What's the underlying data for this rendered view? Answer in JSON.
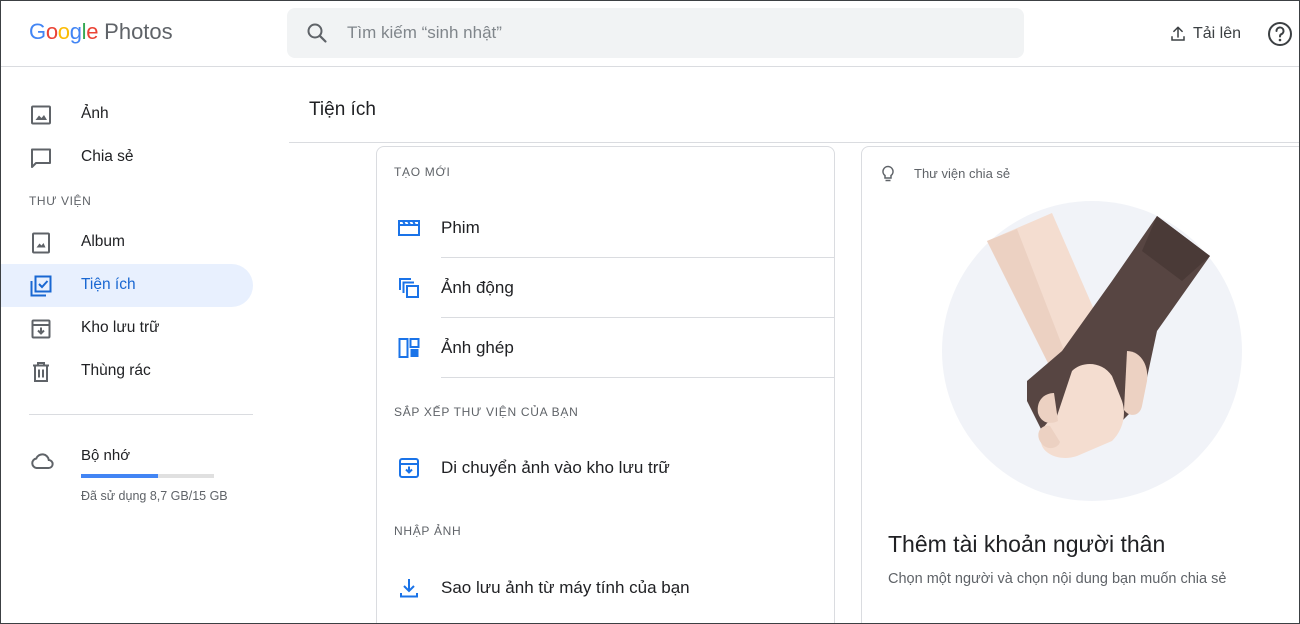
{
  "header": {
    "logo": {
      "google_letters": [
        {
          "char": "G",
          "color": "#4285F4"
        },
        {
          "char": "o",
          "color": "#EA4335"
        },
        {
          "char": "o",
          "color": "#FBBC05"
        },
        {
          "char": "g",
          "color": "#4285F4"
        },
        {
          "char": "l",
          "color": "#34A853"
        },
        {
          "char": "e",
          "color": "#EA4335"
        }
      ],
      "product": "Photos"
    },
    "search": {
      "placeholder": "Tìm kiếm “sinh nhật”",
      "icon": "search-icon"
    },
    "upload_label": "Tải lên",
    "help_icon": "help-icon"
  },
  "sidebar": {
    "items": [
      {
        "label": "Ảnh",
        "icon": "photo-icon"
      },
      {
        "label": "Chia sẻ",
        "icon": "chat-icon"
      }
    ],
    "library_label": "THƯ VIỆN",
    "library_items": [
      {
        "label": "Album",
        "icon": "album-icon"
      },
      {
        "label": "Tiện ích",
        "icon": "utilities-icon",
        "active": true
      },
      {
        "label": "Kho lưu trữ",
        "icon": "archive-icon"
      },
      {
        "label": "Thùng rác",
        "icon": "trash-icon"
      }
    ],
    "storage": {
      "title": "Bộ nhớ",
      "used_text": "Đã sử dụng 8,7 GB/15 GB",
      "used_fraction": 0.58,
      "icon": "cloud-icon"
    }
  },
  "main": {
    "title": "Tiện ích",
    "create": {
      "label": "TẠO MỚI",
      "items": [
        {
          "label": "Phim",
          "icon": "movie-icon"
        },
        {
          "label": "Ảnh động",
          "icon": "animation-icon"
        },
        {
          "label": "Ảnh ghép",
          "icon": "collage-icon"
        }
      ]
    },
    "organize": {
      "label": "SẮP XẾP THƯ VIỆN CỦA BẠN",
      "items": [
        {
          "label": "Di chuyển ảnh vào kho lưu trữ",
          "icon": "archive-move-icon"
        }
      ]
    },
    "import": {
      "label": "NHẬP ẢNH",
      "items": [
        {
          "label": "Sao lưu ảnh từ máy tính của bạn",
          "icon": "download-icon"
        }
      ]
    },
    "shared_card": {
      "tip": "Thư viện chia sẻ",
      "heading": "Thêm tài khoản người thân",
      "subtext": "Chọn một người và chọn nội dung bạn muốn chia sẻ"
    }
  },
  "colors": {
    "accent": "#1967D2",
    "active_bg": "#E8F0FE",
    "icon_blue": "#1A73E8",
    "storage_fill": "#4285F4",
    "search_bg": "#F1F3F4"
  }
}
